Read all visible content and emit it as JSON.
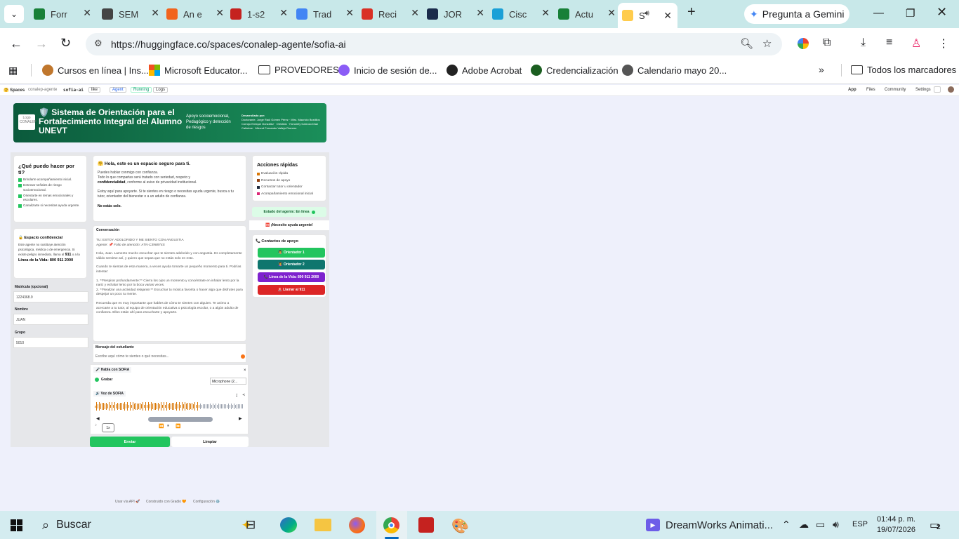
{
  "browser": {
    "tabs": [
      {
        "label": "Forr",
        "icon": "google-forms-icon",
        "color": "#188038"
      },
      {
        "label": "SEM",
        "icon": "openai-icon",
        "color": "#444444"
      },
      {
        "label": "An e",
        "icon": "etsy-icon",
        "color": "#f1641e"
      },
      {
        "label": "1-s2",
        "icon": "pdf-icon",
        "color": "#c5221f"
      },
      {
        "label": "Trad",
        "icon": "google-translate-icon",
        "color": "#4285f4"
      },
      {
        "label": "Reci",
        "icon": "gmail-icon",
        "color": "#d93025"
      },
      {
        "label": "JOR",
        "icon": "d-logo-icon",
        "color": "#1a2b4b"
      },
      {
        "label": "Cisc",
        "icon": "cisco-icon",
        "color": "#1ba0d7"
      },
      {
        "label": "Actu",
        "icon": "refresh-tab-icon",
        "color": "#188038"
      },
      {
        "label": "S",
        "icon": "hugging-face-icon",
        "color": "#ffcc4d"
      }
    ],
    "gemini_label": "Pregunta a Gemini",
    "url": "https://huggingface.co/spaces/conalep-agente/sofia-ai",
    "bookmarks": [
      {
        "label": "Cursos en línea | Ins...",
        "icon": "squirrel-icon"
      },
      {
        "label": "Microsoft Educator...",
        "icon": "microsoft-icon"
      },
      {
        "label": "PROVEDORES",
        "icon": "folder-icon"
      },
      {
        "label": "Inicio de sesión de...",
        "icon": "copilot-icon"
      },
      {
        "label": "Adobe Acrobat",
        "icon": "acrobat-icon"
      },
      {
        "label": "Credencialización",
        "icon": "credential-icon"
      },
      {
        "label": "Calendario mayo 20...",
        "icon": "gym-icon"
      }
    ],
    "all_bookmarks": "Todos los marcadores"
  },
  "hf": {
    "spaces": "Spaces",
    "owner": "conalep-agente",
    "repo": "sofia-ai",
    "like": "like",
    "badge_agent": "Agent",
    "running": "Running",
    "logs": "Logs",
    "nav": [
      "App",
      "Files",
      "Community",
      "Settings"
    ]
  },
  "banner": {
    "logo": "Logo CONALEP",
    "title": "🛡️ Sistema de Orientación para el Fortalecimiento Integral del Alumno UNEVT",
    "subtitle": "Apoyo socioemocional, Pedagógico y detección de riesgos",
    "dev_label": "Desarrollado por:",
    "dev_text": "Doctorante. Jorge Raúl Gómez Pérez · Mtro. Mauricio Bustillos Corrojo Enrique González · Orestido · Honorely Garrozo Díaz Calimbre · Mtrond Fernando Vallejo Romero"
  },
  "left": {
    "help_title": "¿Qué puedo hacer por ti?",
    "help_items": [
      "Brindarte acompañamiento inicial.",
      "Detectar señales de riesgo socioemocional.",
      "Orientarte en temas emocionales y escolares.",
      "Canalizarte si necesitas ayuda urgente."
    ],
    "conf_title": "🔒 Espacio confidencial",
    "conf_text": "Este agente no sustituye atención psicológica, médica o de emergencia. Si existe peligro inmediato, llama al",
    "conf_num": "911",
    "conf_or": "o a la",
    "conf_line": "Línea de la Vida: 800 911 2000",
    "matricula_label": "Matrícula (opcional)",
    "matricula_value": "1224368.9",
    "nombre_label": "Nombre",
    "nombre_value": "JUAN",
    "grupo_label": "Grupo",
    "grupo_value": "5010"
  },
  "welcome": {
    "title": "🤗 Hola, este es un espacio seguro para ti.",
    "p1": "Puedes hablar conmigo con confianza.",
    "p2a": "Todo lo que compartas será tratado con seriedad, respeto y",
    "p2b": "confidencialidad",
    "p2c": ", conforme al aviso de privacidad institucional.",
    "p3": "Estoy aquí para apoyarte. Si te sientes en riesgo o necesitas ayuda urgente, busca a tu tutor, orientador del bienestar o a un adulto de confianza.",
    "p4": "No estás solo."
  },
  "conversation": {
    "label": "Conversación",
    "user_msg": "TU: ESTOY ADOLORIDO Y ME SIENTO CON ANGUSTIA",
    "folio": "Agente: 📌 Folio de atención: ATN-C398874S",
    "lines": [
      "Hola, Juan. Lamento mucho escuchar que te sientes adolorido y con angustia. Es completamente válido sentirse así, y quiero que sepas que no estás solo en esto.",
      "Cuando te sientas de esta manera, a veces ayuda tomarte un pequeño momento para ti. Podrías intentar:",
      "1. **Respirar profundamente:** Cierra los ojos un momento y concéntrate en inhalar lento por la nariz y exhalar lento por la boca varias veces.",
      "2. **Realizar una actividad relajante:** Escuchar tu música favorita o hacer algo que disfrutes para despejar un poco tu mente.",
      "Recuerda que es muy importante que hables de cómo te sientes con alguien. Te animo a acercarte a tu tutor, al equipo de orientación educativa o psicología escolar, o a algún adulto de confianza. Ellos están ahí para escucharte y apoyarte."
    ],
    "msg_label": "Mensaje del estudiante",
    "msg_placeholder": "Escribe aquí cómo te sientes o qué necesitas...",
    "talk_label": "🎤 Habla con SOFIA",
    "record": "Grabar",
    "mic": "Microphone (2...",
    "voice_label": "🔊 Voz de SOFIA",
    "speed": "1x",
    "send": "Enviar",
    "clear": "Limpiar"
  },
  "right": {
    "quick_title": "Acciones rápidas",
    "quick_items": [
      "Evaluación rápida",
      "Recursos de apoyo",
      "Contactar tutor u orientador",
      "Acompañamiento emocional inicial"
    ],
    "status": "Estado del agente: En línea",
    "urgent": "🆘 ¡Necesito ayuda urgente!",
    "contacts_title": "📞 Contactos de apoyo",
    "contacts": [
      {
        "label": "👨‍🏫 Orientador 1",
        "color": "#22c55e"
      },
      {
        "label": "👩‍🏫 Orientador 2",
        "color": "#0f766e"
      },
      {
        "label": "📞 Línea de la Vida: 800 911 2000",
        "color": "#7e22ce"
      },
      {
        "label": "🚨 Llamar al 911",
        "color": "#dc2626"
      }
    ]
  },
  "footer": {
    "api": "Usar vía API 🚀",
    "built": "Construido con Gradio 🧡",
    "config": "Configuración ⚙️"
  },
  "taskbar": {
    "search": "Buscar",
    "app_title": "DreamWorks Animati...",
    "lang": "ESP",
    "time": "01:44 p. m.",
    "date": "19/07/2026",
    "notifications": "2"
  }
}
